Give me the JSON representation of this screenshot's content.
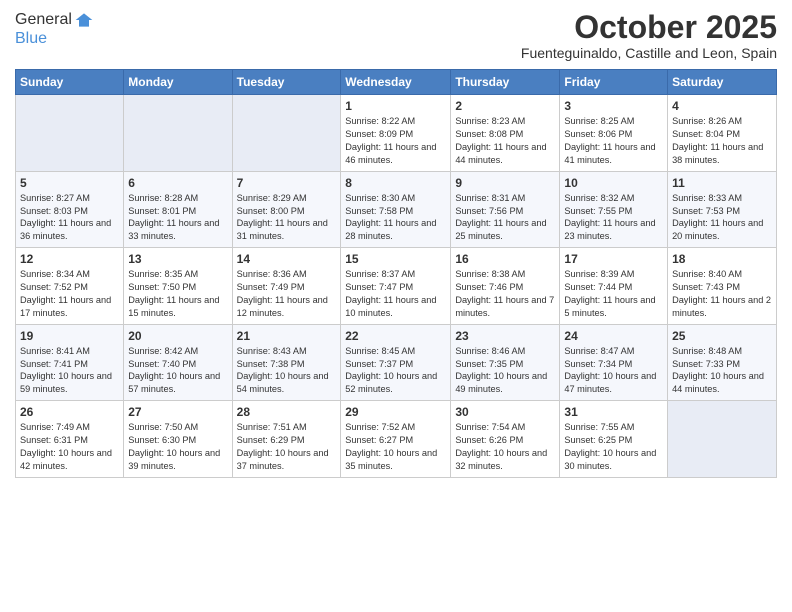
{
  "header": {
    "logo_line1": "General",
    "logo_line2": "Blue",
    "month": "October 2025",
    "location": "Fuenteguinaldo, Castille and Leon, Spain"
  },
  "weekdays": [
    "Sunday",
    "Monday",
    "Tuesday",
    "Wednesday",
    "Thursday",
    "Friday",
    "Saturday"
  ],
  "weeks": [
    [
      {
        "day": "",
        "sunrise": "",
        "sunset": "",
        "daylight": ""
      },
      {
        "day": "",
        "sunrise": "",
        "sunset": "",
        "daylight": ""
      },
      {
        "day": "",
        "sunrise": "",
        "sunset": "",
        "daylight": ""
      },
      {
        "day": "1",
        "sunrise": "Sunrise: 8:22 AM",
        "sunset": "Sunset: 8:09 PM",
        "daylight": "Daylight: 11 hours and 46 minutes."
      },
      {
        "day": "2",
        "sunrise": "Sunrise: 8:23 AM",
        "sunset": "Sunset: 8:08 PM",
        "daylight": "Daylight: 11 hours and 44 minutes."
      },
      {
        "day": "3",
        "sunrise": "Sunrise: 8:25 AM",
        "sunset": "Sunset: 8:06 PM",
        "daylight": "Daylight: 11 hours and 41 minutes."
      },
      {
        "day": "4",
        "sunrise": "Sunrise: 8:26 AM",
        "sunset": "Sunset: 8:04 PM",
        "daylight": "Daylight: 11 hours and 38 minutes."
      }
    ],
    [
      {
        "day": "5",
        "sunrise": "Sunrise: 8:27 AM",
        "sunset": "Sunset: 8:03 PM",
        "daylight": "Daylight: 11 hours and 36 minutes."
      },
      {
        "day": "6",
        "sunrise": "Sunrise: 8:28 AM",
        "sunset": "Sunset: 8:01 PM",
        "daylight": "Daylight: 11 hours and 33 minutes."
      },
      {
        "day": "7",
        "sunrise": "Sunrise: 8:29 AM",
        "sunset": "Sunset: 8:00 PM",
        "daylight": "Daylight: 11 hours and 31 minutes."
      },
      {
        "day": "8",
        "sunrise": "Sunrise: 8:30 AM",
        "sunset": "Sunset: 7:58 PM",
        "daylight": "Daylight: 11 hours and 28 minutes."
      },
      {
        "day": "9",
        "sunrise": "Sunrise: 8:31 AM",
        "sunset": "Sunset: 7:56 PM",
        "daylight": "Daylight: 11 hours and 25 minutes."
      },
      {
        "day": "10",
        "sunrise": "Sunrise: 8:32 AM",
        "sunset": "Sunset: 7:55 PM",
        "daylight": "Daylight: 11 hours and 23 minutes."
      },
      {
        "day": "11",
        "sunrise": "Sunrise: 8:33 AM",
        "sunset": "Sunset: 7:53 PM",
        "daylight": "Daylight: 11 hours and 20 minutes."
      }
    ],
    [
      {
        "day": "12",
        "sunrise": "Sunrise: 8:34 AM",
        "sunset": "Sunset: 7:52 PM",
        "daylight": "Daylight: 11 hours and 17 minutes."
      },
      {
        "day": "13",
        "sunrise": "Sunrise: 8:35 AM",
        "sunset": "Sunset: 7:50 PM",
        "daylight": "Daylight: 11 hours and 15 minutes."
      },
      {
        "day": "14",
        "sunrise": "Sunrise: 8:36 AM",
        "sunset": "Sunset: 7:49 PM",
        "daylight": "Daylight: 11 hours and 12 minutes."
      },
      {
        "day": "15",
        "sunrise": "Sunrise: 8:37 AM",
        "sunset": "Sunset: 7:47 PM",
        "daylight": "Daylight: 11 hours and 10 minutes."
      },
      {
        "day": "16",
        "sunrise": "Sunrise: 8:38 AM",
        "sunset": "Sunset: 7:46 PM",
        "daylight": "Daylight: 11 hours and 7 minutes."
      },
      {
        "day": "17",
        "sunrise": "Sunrise: 8:39 AM",
        "sunset": "Sunset: 7:44 PM",
        "daylight": "Daylight: 11 hours and 5 minutes."
      },
      {
        "day": "18",
        "sunrise": "Sunrise: 8:40 AM",
        "sunset": "Sunset: 7:43 PM",
        "daylight": "Daylight: 11 hours and 2 minutes."
      }
    ],
    [
      {
        "day": "19",
        "sunrise": "Sunrise: 8:41 AM",
        "sunset": "Sunset: 7:41 PM",
        "daylight": "Daylight: 10 hours and 59 minutes."
      },
      {
        "day": "20",
        "sunrise": "Sunrise: 8:42 AM",
        "sunset": "Sunset: 7:40 PM",
        "daylight": "Daylight: 10 hours and 57 minutes."
      },
      {
        "day": "21",
        "sunrise": "Sunrise: 8:43 AM",
        "sunset": "Sunset: 7:38 PM",
        "daylight": "Daylight: 10 hours and 54 minutes."
      },
      {
        "day": "22",
        "sunrise": "Sunrise: 8:45 AM",
        "sunset": "Sunset: 7:37 PM",
        "daylight": "Daylight: 10 hours and 52 minutes."
      },
      {
        "day": "23",
        "sunrise": "Sunrise: 8:46 AM",
        "sunset": "Sunset: 7:35 PM",
        "daylight": "Daylight: 10 hours and 49 minutes."
      },
      {
        "day": "24",
        "sunrise": "Sunrise: 8:47 AM",
        "sunset": "Sunset: 7:34 PM",
        "daylight": "Daylight: 10 hours and 47 minutes."
      },
      {
        "day": "25",
        "sunrise": "Sunrise: 8:48 AM",
        "sunset": "Sunset: 7:33 PM",
        "daylight": "Daylight: 10 hours and 44 minutes."
      }
    ],
    [
      {
        "day": "26",
        "sunrise": "Sunrise: 7:49 AM",
        "sunset": "Sunset: 6:31 PM",
        "daylight": "Daylight: 10 hours and 42 minutes."
      },
      {
        "day": "27",
        "sunrise": "Sunrise: 7:50 AM",
        "sunset": "Sunset: 6:30 PM",
        "daylight": "Daylight: 10 hours and 39 minutes."
      },
      {
        "day": "28",
        "sunrise": "Sunrise: 7:51 AM",
        "sunset": "Sunset: 6:29 PM",
        "daylight": "Daylight: 10 hours and 37 minutes."
      },
      {
        "day": "29",
        "sunrise": "Sunrise: 7:52 AM",
        "sunset": "Sunset: 6:27 PM",
        "daylight": "Daylight: 10 hours and 35 minutes."
      },
      {
        "day": "30",
        "sunrise": "Sunrise: 7:54 AM",
        "sunset": "Sunset: 6:26 PM",
        "daylight": "Daylight: 10 hours and 32 minutes."
      },
      {
        "day": "31",
        "sunrise": "Sunrise: 7:55 AM",
        "sunset": "Sunset: 6:25 PM",
        "daylight": "Daylight: 10 hours and 30 minutes."
      },
      {
        "day": "",
        "sunrise": "",
        "sunset": "",
        "daylight": ""
      }
    ]
  ]
}
